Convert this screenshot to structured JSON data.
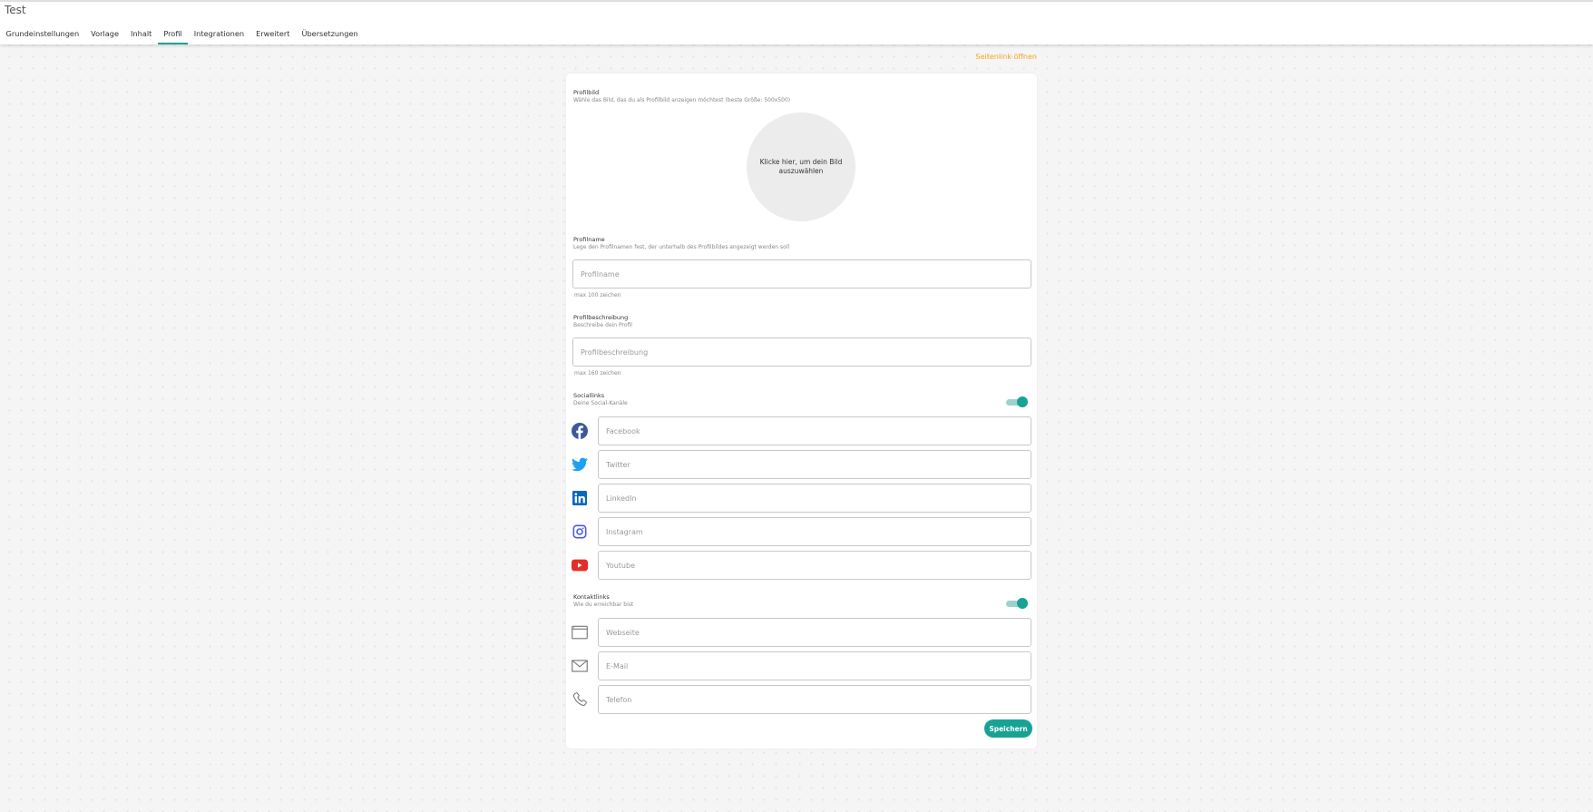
{
  "app": {
    "title": "Test"
  },
  "tabs": [
    {
      "label": "Grundeinstellungen",
      "active": false
    },
    {
      "label": "Vorlage",
      "active": false
    },
    {
      "label": "Inhalt",
      "active": false
    },
    {
      "label": "Profil",
      "active": true
    },
    {
      "label": "Integrationen",
      "active": false
    },
    {
      "label": "Erweitert",
      "active": false
    },
    {
      "label": "Übersetzungen",
      "active": false
    }
  ],
  "open_link_label": "Seitenlink öffnen",
  "profile_image": {
    "title": "Profilbild",
    "subtitle": "Wähle das Bild, das du als Profilbild anzeigen möchtest (beste Größe: 500x500)",
    "placeholder": "Klicke hier, um dein Bild auszuwählen"
  },
  "profile_name": {
    "title": "Profilname",
    "subtitle": "Lege den Profilnamen fest, der unterhalb des Profilbildes angezeigt werden soll",
    "placeholder": "Profilname",
    "value": "",
    "hint": "max 100 zeichen"
  },
  "profile_description": {
    "title": "Profilbeschreibung",
    "subtitle": "Beschreibe dein Profil",
    "placeholder": "Profilbeschreibung",
    "value": "",
    "hint": "max 160 zeichen"
  },
  "social_links": {
    "title": "Sociallinks",
    "subtitle": "Deine Social-Kanäle",
    "enabled": true,
    "items": [
      {
        "icon": "facebook-icon",
        "placeholder": "Facebook",
        "value": ""
      },
      {
        "icon": "twitter-icon",
        "placeholder": "Twitter",
        "value": ""
      },
      {
        "icon": "linkedin-icon",
        "placeholder": "LinkedIn",
        "value": ""
      },
      {
        "icon": "instagram-icon",
        "placeholder": "Instagram",
        "value": ""
      },
      {
        "icon": "youtube-icon",
        "placeholder": "Youtube",
        "value": ""
      }
    ]
  },
  "contact_links": {
    "title": "Kontaktlinks",
    "subtitle": "Wie du erreichbar bist",
    "enabled": true,
    "items": [
      {
        "icon": "website-icon",
        "placeholder": "Webseite",
        "value": ""
      },
      {
        "icon": "mail-icon",
        "placeholder": "E-Mail",
        "value": ""
      },
      {
        "icon": "phone-icon",
        "placeholder": "Telefon",
        "value": ""
      }
    ]
  },
  "save_label": "Speichern",
  "colors": {
    "accent": "#17a394",
    "link": "#f5a623",
    "facebook": "#3b5998",
    "twitter": "#1da1f2",
    "linkedin": "#0a66c2",
    "instagram": "#4f5bd5",
    "youtube": "#e52d27"
  }
}
